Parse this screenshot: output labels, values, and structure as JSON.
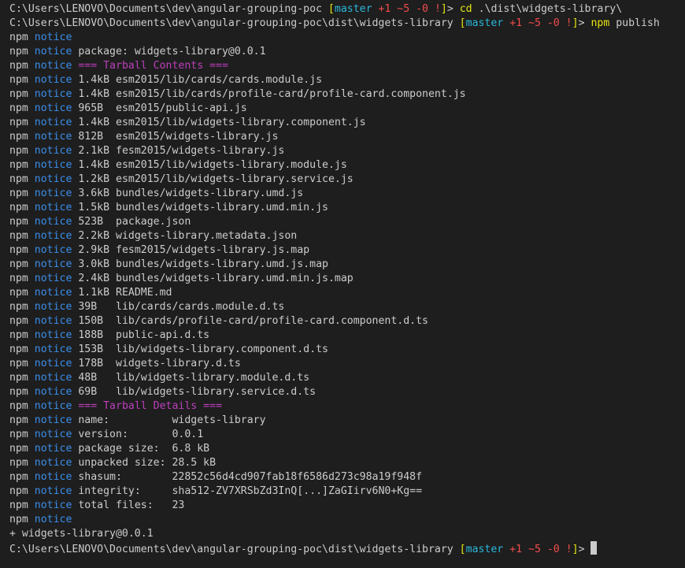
{
  "prompt": {
    "path1": "C:\\Users\\LENOVO\\Documents\\dev\\angular-grouping-poc",
    "path2": "C:\\Users\\LENOVO\\Documents\\dev\\angular-grouping-poc\\dist\\widgets-library",
    "open": " [",
    "branch": "master",
    "ahead": " +1",
    "modified": " ~5",
    "deleted": " -0",
    "bang": " !",
    "close": "]",
    "gt": "> "
  },
  "commands": {
    "cd_word": "cd",
    "cd_arg": " .\\dist\\widgets-library\\",
    "npm_word": "npm",
    "npm_arg": " publish"
  },
  "npm_label": "npm",
  "notice_label": "notice",
  "package_line": " package: widgets-library@0.0.1",
  "contents_header": " === Tarball Contents ===",
  "files": [
    " 1.4kB esm2015/lib/cards/cards.module.js",
    " 1.4kB esm2015/lib/cards/profile-card/profile-card.component.js",
    " 965B  esm2015/public-api.js",
    " 1.4kB esm2015/lib/widgets-library.component.js",
    " 812B  esm2015/widgets-library.js",
    " 2.1kB fesm2015/widgets-library.js",
    " 1.4kB esm2015/lib/widgets-library.module.js",
    " 1.2kB esm2015/lib/widgets-library.service.js",
    " 3.6kB bundles/widgets-library.umd.js",
    " 1.5kB bundles/widgets-library.umd.min.js",
    " 523B  package.json",
    " 2.2kB widgets-library.metadata.json",
    " 2.9kB fesm2015/widgets-library.js.map",
    " 3.0kB bundles/widgets-library.umd.js.map",
    " 2.4kB bundles/widgets-library.umd.min.js.map",
    " 1.1kB README.md",
    " 39B   lib/cards/cards.module.d.ts",
    " 150B  lib/cards/profile-card/profile-card.component.d.ts",
    " 188B  public-api.d.ts",
    " 153B  lib/widgets-library.component.d.ts",
    " 178B  widgets-library.d.ts",
    " 48B   lib/widgets-library.module.d.ts",
    " 69B   lib/widgets-library.service.d.ts"
  ],
  "details_header": " === Tarball Details ===",
  "details": [
    " name:          widgets-library",
    " version:       0.0.1",
    " package size:  6.8 kB",
    " unpacked size: 28.5 kB",
    " shasum:        22852c56d4cd907fab18f6586d273c98a19f948f",
    " integrity:     sha512-ZV7XRSbZd3InQ[...]ZaGIirv6N0+Kg==",
    " total files:   23"
  ],
  "published_line": "+ widgets-library@0.0.1"
}
